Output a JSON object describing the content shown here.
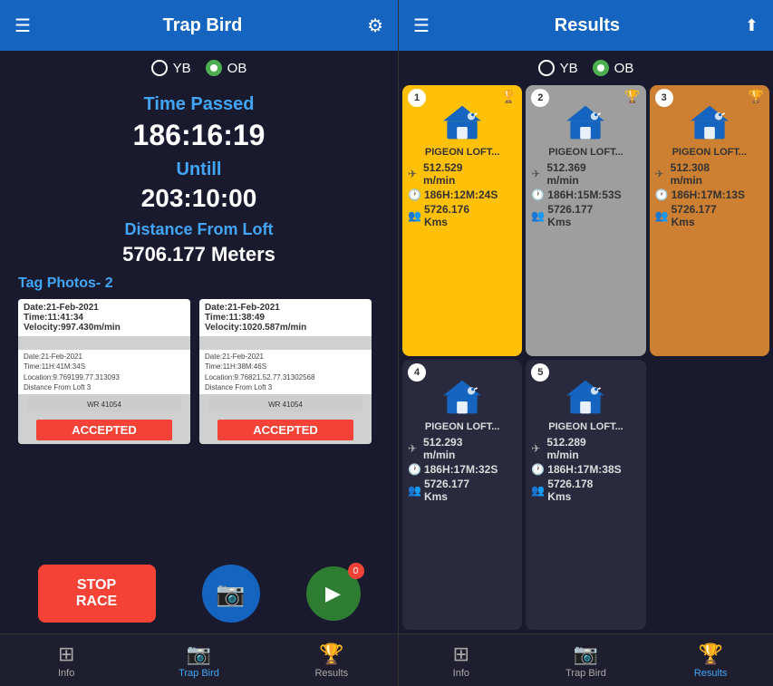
{
  "left": {
    "header": {
      "title": "Trap Bird",
      "hamburger": "☰",
      "gear": "⚙"
    },
    "yb_ob": {
      "yb_label": "YB",
      "ob_label": "OB",
      "yb_checked": false,
      "ob_checked": true
    },
    "time_passed_label": "Time Passed",
    "time_passed_value": "186:16:19",
    "untill_label": "Untill",
    "untill_value": "203:10:00",
    "distance_label": "Distance From Loft",
    "distance_value": "5706.177 Meters",
    "tag_photos_label": "Tag Photos- 2",
    "photos": [
      {
        "header": "Date:21-Feb-2021\nTime:11:41:34\nVelocity:997.430m/min",
        "lines": "Date:21-Feb-2021\nTime:11H:41M:34S\nLocation:9.769199.77.313093\nDistance From Loft 3",
        "accepted": "ACCEPTED"
      },
      {
        "header": "Date:21-Feb-2021\nTime:11:38:49\nVelocity:1020.587m/min",
        "lines": "Date:21-Feb-2021\nTime:11H:38M:46S\nLocation:9.76821.52.77.31302568\nDistance From Loft 3",
        "accepted": "ACCEPTED"
      }
    ],
    "buttons": {
      "stop_race": "STOP RACE",
      "arrow_badge": "0"
    },
    "bottom_nav": [
      {
        "label": "Info",
        "icon": "⊞",
        "active": false
      },
      {
        "label": "Trap Bird",
        "icon": "📷",
        "active": true
      },
      {
        "label": "Results",
        "icon": "🏆",
        "active": false
      }
    ]
  },
  "right": {
    "header": {
      "title": "Results",
      "hamburger": "☰",
      "share": "⬆"
    },
    "yb_ob": {
      "yb_label": "YB",
      "ob_label": "OB",
      "yb_checked": false,
      "ob_checked": true
    },
    "cards": [
      {
        "rank": "1",
        "trophy": true,
        "name": "PIGEON LOFT...",
        "speed": "512.529",
        "speed_unit": "m/min",
        "time": "186H:12M:",
        "time2": "24S",
        "distance": "5726.176",
        "dist_unit": "Kms",
        "style": "gold"
      },
      {
        "rank": "2",
        "trophy": true,
        "name": "PIGEON LOFT...",
        "speed": "512.369",
        "speed_unit": "m/min",
        "time": "186H:15M:",
        "time2": "53S",
        "distance": "5726.177",
        "dist_unit": "Kms",
        "style": "silver"
      },
      {
        "rank": "3",
        "trophy": true,
        "name": "PIGEON LOFT...",
        "speed": "512.308",
        "speed_unit": "m/min",
        "time": "186H:17M:",
        "time2": "13S",
        "distance": "5726.177",
        "dist_unit": "Kms",
        "style": "bronze"
      },
      {
        "rank": "4",
        "trophy": false,
        "name": "PIGEON LOFT...",
        "speed": "512.293",
        "speed_unit": "m/min",
        "time": "186H:17M:",
        "time2": "32S",
        "distance": "5726.177",
        "dist_unit": "Kms",
        "style": "dark"
      },
      {
        "rank": "5",
        "trophy": false,
        "name": "PIGEON LOFT...",
        "speed": "512.289",
        "speed_unit": "m/min",
        "time": "186H:17M:",
        "time2": "38S",
        "distance": "5726.178",
        "dist_unit": "Kms",
        "style": "dark"
      }
    ],
    "bottom_nav": [
      {
        "label": "Info",
        "icon": "⊞",
        "active": false
      },
      {
        "label": "Trap Bird",
        "icon": "📷",
        "active": false
      },
      {
        "label": "Results",
        "icon": "🏆",
        "active": true
      }
    ]
  }
}
